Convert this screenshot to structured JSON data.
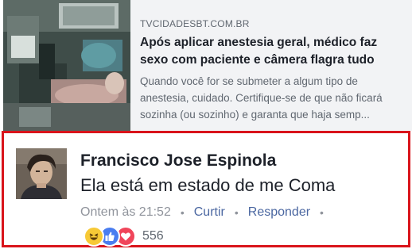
{
  "link_preview": {
    "domain": "TVCIDADESBT.COM.BR",
    "title_line1": "Após aplicar anestesia geral, médico faz",
    "title_line2": "sexo com paciente e câmera flagra tudo",
    "desc_line1": "Quando você for se submeter a algum tipo de",
    "desc_line2": "anestesia, cuidado. Certifique-se de que não ficará",
    "desc_line3": "sozinha (ou sozinho) e garanta que haja semp..."
  },
  "comment": {
    "author": "Francisco Jose Espinola",
    "text": "Ela está em estado de me Coma",
    "timestamp": "Ontem às 21:52",
    "separator": "•",
    "like_label": "Curtir",
    "reply_label": "Responder",
    "reaction_count": "556",
    "reactions": [
      "haha-icon",
      "like-icon",
      "love-icon"
    ]
  },
  "colors": {
    "highlight_border": "#d9141b",
    "link_blue": "#4b67a1",
    "card_background": "#f2f3f5"
  }
}
